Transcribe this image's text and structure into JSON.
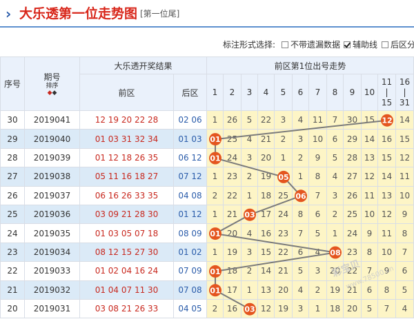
{
  "title": {
    "arrow": "›",
    "main": "大乐透第一位走势图",
    "sub": "[第一位尾]"
  },
  "options": {
    "label": "标注形式选择:",
    "items": [
      {
        "label": "不带遗漏数据",
        "checked": false
      },
      {
        "label": "辅助线",
        "checked": true
      },
      {
        "label": "后区分",
        "checked": false
      }
    ]
  },
  "headers": {
    "seq": "序号",
    "period": "期号",
    "sort_label": "排序",
    "sort_up": "◆",
    "sort_down": "◆",
    "result_group": "大乐透开奖结果",
    "front": "前区",
    "back": "后区",
    "trend_group": "前区第1位出号走势",
    "columns": [
      "1",
      "2",
      "3",
      "4",
      "5",
      "6",
      "7",
      "8",
      "9",
      "10"
    ],
    "range1": {
      "top": "11",
      "mid": "|",
      "bot": "15"
    },
    "range2": {
      "top": "16",
      "mid": "|",
      "bot": "31"
    }
  },
  "rows": [
    {
      "seq": "30",
      "period": "2019041",
      "front": "12 19 20 22 28",
      "back": "02 06",
      "alt": false,
      "cells": [
        "1",
        "26",
        "5",
        "22",
        "3",
        "4",
        "11",
        "7",
        "30",
        "15",
        "12",
        "14"
      ],
      "hit": 10
    },
    {
      "seq": "29",
      "period": "2019040",
      "front": "01 03 31 32 34",
      "back": "01 03",
      "alt": true,
      "cells": [
        "01",
        "25",
        "4",
        "21",
        "2",
        "3",
        "10",
        "6",
        "29",
        "14",
        "16",
        "15"
      ],
      "hit": 0
    },
    {
      "seq": "28",
      "period": "2019039",
      "front": "01 12 18 26 35",
      "back": "06 12",
      "alt": false,
      "cells": [
        "01",
        "24",
        "3",
        "20",
        "1",
        "2",
        "9",
        "5",
        "28",
        "13",
        "15",
        "12"
      ],
      "hit": 0
    },
    {
      "seq": "27",
      "period": "2019038",
      "front": "05 11 16 18 27",
      "back": "07 12",
      "alt": true,
      "cells": [
        "1",
        "23",
        "2",
        "19",
        "05",
        "1",
        "8",
        "4",
        "27",
        "12",
        "14",
        "11"
      ],
      "hit": 4
    },
    {
      "seq": "26",
      "period": "2019037",
      "front": "06 16 26 33 35",
      "back": "04 08",
      "alt": false,
      "cells": [
        "2",
        "22",
        "1",
        "18",
        "25",
        "06",
        "7",
        "3",
        "26",
        "11",
        "13",
        "10"
      ],
      "hit": 5
    },
    {
      "seq": "25",
      "period": "2019036",
      "front": "03 09 21 28 30",
      "back": "01 12",
      "alt": true,
      "cells": [
        "1",
        "21",
        "03",
        "17",
        "24",
        "8",
        "6",
        "2",
        "25",
        "10",
        "12",
        "9"
      ],
      "hit": 2
    },
    {
      "seq": "24",
      "period": "2019035",
      "front": "01 03 05 07 18",
      "back": "08 09",
      "alt": false,
      "cells": [
        "01",
        "20",
        "4",
        "16",
        "23",
        "7",
        "5",
        "1",
        "24",
        "9",
        "11",
        "8"
      ],
      "hit": 0
    },
    {
      "seq": "23",
      "period": "2019034",
      "front": "08 12 15 27 30",
      "back": "01 02",
      "alt": true,
      "cells": [
        "1",
        "19",
        "3",
        "15",
        "22",
        "6",
        "4",
        "08",
        "23",
        "8",
        "10",
        "7"
      ],
      "hit": 7
    },
    {
      "seq": "22",
      "period": "2019033",
      "front": "01 02 04 16 24",
      "back": "07 09",
      "alt": false,
      "cells": [
        "01",
        "18",
        "2",
        "14",
        "21",
        "5",
        "3",
        "20",
        "22",
        "7",
        "9",
        "6"
      ],
      "hit": 0
    },
    {
      "seq": "21",
      "period": "2019032",
      "front": "01 04 07 11 30",
      "back": "07 08",
      "alt": true,
      "cells": [
        "01",
        "17",
        "1",
        "13",
        "20",
        "4",
        "2",
        "19",
        "21",
        "6",
        "8",
        "5"
      ],
      "hit": 0
    },
    {
      "seq": "20",
      "period": "2019031",
      "front": "03 08 21 26 33",
      "back": "04 05",
      "alt": false,
      "cells": [
        "2",
        "16",
        "03",
        "12",
        "19",
        "3",
        "1",
        "18",
        "20",
        "5",
        "7",
        "4"
      ],
      "hit": 2
    }
  ],
  "watermark": {
    "main": "彩宝贝",
    "sub": "www.78500.cn"
  },
  "colors": {
    "ball": "#e4551f",
    "line": "#7a7a7a",
    "front": "#c8281e",
    "back": "#2a5caa"
  }
}
